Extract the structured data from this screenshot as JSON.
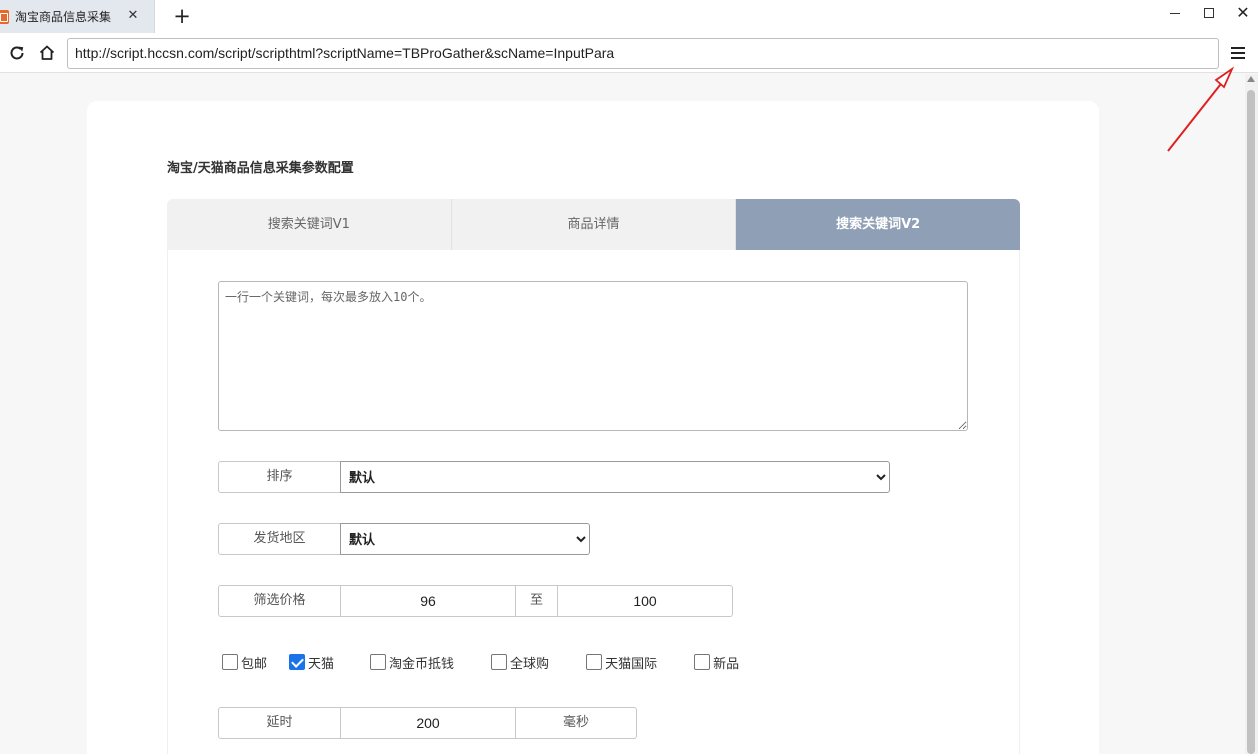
{
  "browser": {
    "tab_title": "淘宝商品信息采集",
    "tab_close": "✕",
    "new_tab": "+",
    "url": "http://script.hccsn.com/script/scripthtml?scriptName=TBProGather&scName=InputPara",
    "window_close": "✕"
  },
  "form": {
    "title": "淘宝/天猫商品信息采集参数配置",
    "tabs": [
      {
        "label": "搜索关键词V1",
        "active": false
      },
      {
        "label": "商品详情",
        "active": false
      },
      {
        "label": "搜索关键词V2",
        "active": true
      }
    ],
    "keywords": {
      "value": "",
      "placeholder": "一行一个关键词，每次最多放入10个。"
    },
    "sort": {
      "label": "排序",
      "selected": "默认"
    },
    "region": {
      "label": "发货地区",
      "selected": "默认"
    },
    "price": {
      "label": "筛选价格",
      "min": "96",
      "separator": "至",
      "max": "100"
    },
    "filters": [
      {
        "label": "包邮",
        "checked": false
      },
      {
        "label": "天猫",
        "checked": true
      },
      {
        "label": "淘金币抵钱",
        "checked": false
      },
      {
        "label": "全球购",
        "checked": false
      },
      {
        "label": "天猫国际",
        "checked": false
      },
      {
        "label": "新品",
        "checked": false
      }
    ],
    "delay": {
      "label": "延时",
      "value": "200",
      "unit": "毫秒"
    }
  },
  "colors": {
    "active_tab": "#8fa0b6",
    "checkbox_on": "#1a73e8",
    "annotation_arrow": "#e02020"
  }
}
